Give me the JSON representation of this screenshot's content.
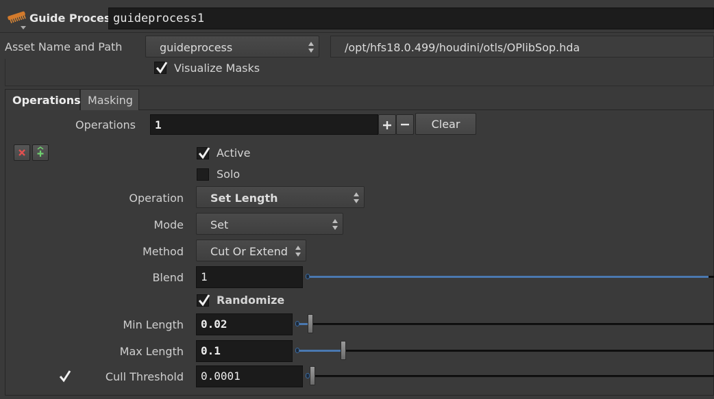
{
  "header": {
    "node_type": "Guide Process",
    "node_name": "guideprocess1"
  },
  "asset": {
    "label": "Asset Name and Path",
    "name": "guideprocess",
    "path": "/opt/hfs18.0.499/houdini/otls/OPlibSop.hda"
  },
  "visualize_masks": {
    "label": "Visualize Masks",
    "checked": true
  },
  "tabs": [
    {
      "label": "Operations",
      "active": true
    },
    {
      "label": "Masking",
      "active": false
    }
  ],
  "operations": {
    "label": "Operations",
    "count": "1",
    "clear_label": "Clear"
  },
  "params": {
    "active": {
      "label": "Active",
      "checked": true
    },
    "solo": {
      "label": "Solo",
      "checked": false
    },
    "operation": {
      "label": "Operation",
      "value": "Set Length"
    },
    "mode": {
      "label": "Mode",
      "value": "Set"
    },
    "method": {
      "label": "Method",
      "value": "Cut Or Extend"
    },
    "blend": {
      "label": "Blend",
      "value": "1",
      "slider_fraction": 1.0
    },
    "randomize": {
      "label": "Randomize",
      "checked": true
    },
    "min_length": {
      "label": "Min Length",
      "value": "0.02",
      "slider_fraction": 0.02
    },
    "max_length": {
      "label": "Max Length",
      "value": "0.1",
      "slider_fraction": 0.1
    },
    "cull_threshold": {
      "label": "Cull Threshold",
      "value": "0.0001",
      "checked": true,
      "slider_fraction": 0.0
    }
  },
  "colors": {
    "accent": "#4a78b0",
    "remove": "#e05050",
    "add": "#6fcf6f",
    "background": "#3a3a3a",
    "field": "#1b1b1b"
  },
  "icons": [
    "comb-icon",
    "dropdown-arrows-icon",
    "checkmark-icon",
    "plus-icon",
    "minus-icon",
    "remove-x-icon",
    "insert-plus-icon"
  ]
}
